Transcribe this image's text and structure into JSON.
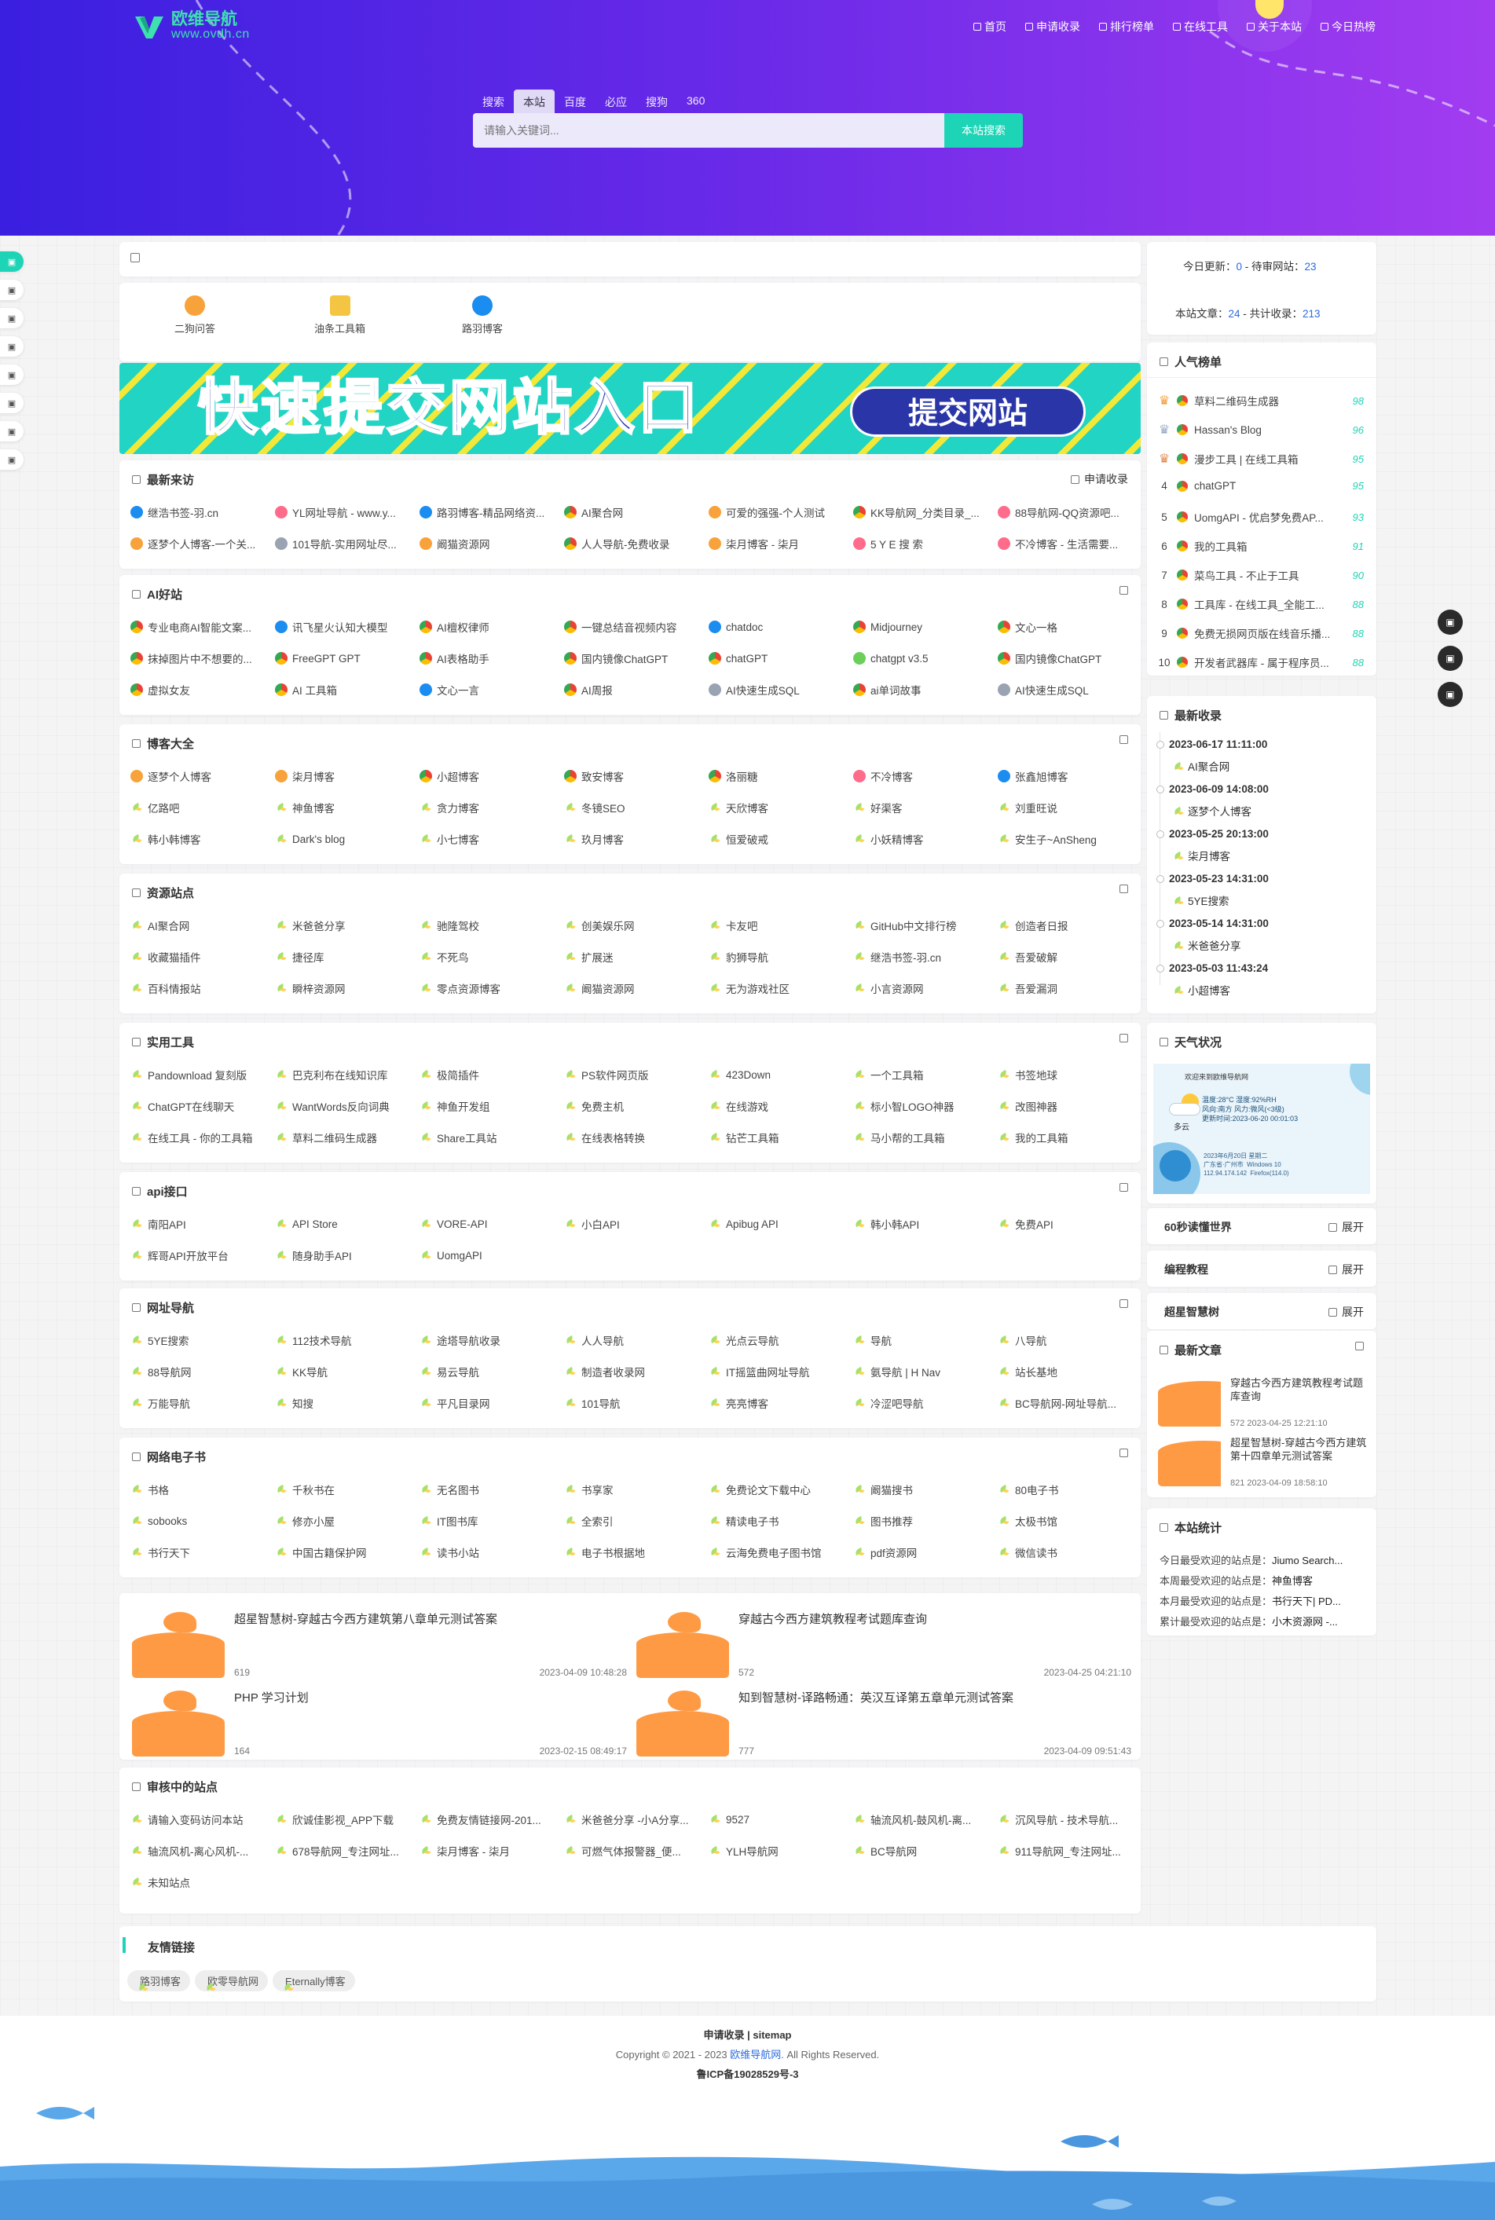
{
  "logo": {
    "title": "欧维导航",
    "url": "www.ovdh.cn"
  },
  "nav": [
    "首页",
    "申请收录",
    "排行榜单",
    "在线工具",
    "关于本站",
    "今日热榜"
  ],
  "search": {
    "tabs": [
      "搜索",
      "本站",
      "百度",
      "必应",
      "搜狗",
      "360"
    ],
    "active": 1,
    "placeholder": "请输入关键词...",
    "button": "本站搜索"
  },
  "hot_icons": [
    {
      "label": "二狗问答",
      "color": "#f7a23a"
    },
    {
      "label": "油条工具箱",
      "color": "#f4c542"
    },
    {
      "label": "路羽博客",
      "color": "#1b8cf0"
    }
  ],
  "banner": {
    "left": "快速提交网站入口",
    "right": "提交网站"
  },
  "sections": [
    {
      "id": "latest",
      "title": "最新来访",
      "right": "申请收录",
      "items": [
        [
          "书",
          "继浩书签-羽.cn"
        ],
        [
          "c5",
          "YL网址导航 - www.y..."
        ],
        [
          "c3",
          "路羽博客-精品网络资..."
        ],
        [
          "c1",
          "AI聚合网"
        ],
        [
          "c2",
          "可爱的强强-个人测试"
        ],
        [
          "c1",
          "KK导航网_分类目录_..."
        ],
        [
          "c5",
          "88导航网-QQ资源吧..."
        ],
        [
          "c2",
          "逐梦个人博客-一个关..."
        ],
        [
          "c6",
          "101导航-实用网址尽..."
        ],
        [
          "c2",
          "阚猫资源网"
        ],
        [
          "c1",
          "人人导航-免费收录"
        ],
        [
          "c2",
          "柒月博客 - 柒月"
        ],
        [
          "c5",
          "5 Y E 搜 索"
        ],
        [
          "c5",
          "不冷博客 - 生活需要..."
        ]
      ]
    },
    {
      "id": "ai",
      "title": "AI好站",
      "right": "",
      "items": [
        [
          "c1",
          "专业电商AI智能文案..."
        ],
        [
          "c3",
          "讯飞星火认知大模型"
        ],
        [
          "c1",
          "AI檀权律师"
        ],
        [
          "c1",
          "一键总结音视频内容"
        ],
        [
          "c3",
          "chatdoc"
        ],
        [
          "c1",
          "Midjourney"
        ],
        [
          "c1",
          "文心一格"
        ],
        [
          "c1",
          "抹掉图片中不想要的..."
        ],
        [
          "c1",
          "FreeGPT GPT"
        ],
        [
          "c1",
          "AI表格助手"
        ],
        [
          "c1",
          "国内镜像ChatGPT"
        ],
        [
          "c1",
          "chatGPT"
        ],
        [
          "c4",
          "chatgpt v3.5"
        ],
        [
          "c1",
          "国内镜像ChatGPT"
        ],
        [
          "c1",
          "虚拟女友"
        ],
        [
          "c1",
          "AI 工具箱"
        ],
        [
          "c3",
          "文心一言"
        ],
        [
          "c1",
          "AI周报"
        ],
        [
          "c6",
          "AI快速生成SQL"
        ],
        [
          "c1",
          "ai单词故事"
        ],
        [
          "c6",
          "AI快速生成SQL"
        ]
      ]
    },
    {
      "id": "blog",
      "title": "博客大全",
      "right": "",
      "items": [
        [
          "c2",
          "逐梦个人博客"
        ],
        [
          "c2",
          "柒月博客"
        ],
        [
          "c1",
          "小超博客"
        ],
        [
          "c1",
          "致安博客"
        ],
        [
          "c1",
          "洛丽糖"
        ],
        [
          "c5",
          "不冷博客"
        ],
        [
          "c3",
          "张鑫旭博客"
        ],
        [
          "leaf",
          "亿路吧"
        ],
        [
          "leaf",
          "神鱼博客"
        ],
        [
          "leaf",
          "贪力博客"
        ],
        [
          "leaf",
          "冬镜SEO"
        ],
        [
          "leaf",
          "天欣博客"
        ],
        [
          "leaf",
          "好渠客"
        ],
        [
          "leaf",
          "刘重旺说"
        ],
        [
          "leaf",
          "韩小韩博客"
        ],
        [
          "leaf",
          "Dark's blog"
        ],
        [
          "leaf",
          "小七博客"
        ],
        [
          "leaf",
          "玖月博客"
        ],
        [
          "leaf",
          "恒爱破戒"
        ],
        [
          "leaf",
          "小妖精博客"
        ],
        [
          "leaf",
          "安生子~AnSheng"
        ]
      ]
    },
    {
      "id": "res",
      "title": "资源站点",
      "right": "",
      "items": [
        [
          "leaf",
          "AI聚合网"
        ],
        [
          "leaf",
          "米爸爸分享"
        ],
        [
          "leaf",
          "驰隆驾校"
        ],
        [
          "leaf",
          "创美娱乐网"
        ],
        [
          "leaf",
          "卡友吧"
        ],
        [
          "leaf",
          "GitHub中文排行榜"
        ],
        [
          "leaf",
          "创造者日报"
        ],
        [
          "leaf",
          "收藏猫插件"
        ],
        [
          "leaf",
          "捷径库"
        ],
        [
          "leaf",
          "不死鸟"
        ],
        [
          "leaf",
          "扩展迷"
        ],
        [
          "leaf",
          "豹狮导航"
        ],
        [
          "leaf",
          "继浩书签-羽.cn"
        ],
        [
          "leaf",
          "吾爱破解"
        ],
        [
          "leaf",
          "百科情报站"
        ],
        [
          "leaf",
          "瞬梓资源网"
        ],
        [
          "leaf",
          "零点资源博客"
        ],
        [
          "leaf",
          "阚猫资源网"
        ],
        [
          "leaf",
          "无为游戏社区"
        ],
        [
          "leaf",
          "小言资源网"
        ],
        [
          "leaf",
          "吾爱漏洞"
        ]
      ]
    },
    {
      "id": "tools",
      "title": "实用工具",
      "right": "",
      "items": [
        [
          "leaf",
          "Pandownload 复刻版"
        ],
        [
          "leaf",
          "巴克利布在线知识库"
        ],
        [
          "leaf",
          "极简插件"
        ],
        [
          "leaf",
          "PS软件网页版"
        ],
        [
          "leaf",
          "423Down"
        ],
        [
          "leaf",
          "一个工具箱"
        ],
        [
          "leaf",
          "书签地球"
        ],
        [
          "leaf",
          "ChatGPT在线聊天"
        ],
        [
          "leaf",
          "WantWords反向词典"
        ],
        [
          "leaf",
          "神鱼开发组"
        ],
        [
          "leaf",
          "免费主机"
        ],
        [
          "leaf",
          "在线游戏"
        ],
        [
          "leaf",
          "标小智LOGO神器"
        ],
        [
          "leaf",
          "改图神器"
        ],
        [
          "leaf",
          "在线工具 - 你的工具箱"
        ],
        [
          "leaf",
          "草料二维码生成器"
        ],
        [
          "leaf",
          "Share工具站"
        ],
        [
          "leaf",
          "在线表格转换"
        ],
        [
          "leaf",
          "钻芒工具箱"
        ],
        [
          "leaf",
          "马小帮的工具箱"
        ],
        [
          "leaf",
          "我的工具箱"
        ]
      ]
    },
    {
      "id": "api",
      "title": "api接口",
      "right": "",
      "items": [
        [
          "leaf",
          "南阳API"
        ],
        [
          "leaf",
          "API Store"
        ],
        [
          "leaf",
          "VORE-API"
        ],
        [
          "leaf",
          "小白API"
        ],
        [
          "leaf",
          "Apibug API"
        ],
        [
          "leaf",
          "韩小韩API"
        ],
        [
          "leaf",
          "免费API"
        ],
        [
          "leaf",
          "辉哥API开放平台"
        ],
        [
          "leaf",
          "随身助手API"
        ],
        [
          "leaf",
          "UomgAPI"
        ]
      ]
    },
    {
      "id": "nav",
      "title": "网址导航",
      "right": "",
      "items": [
        [
          "leaf",
          "5YE搜索"
        ],
        [
          "leaf",
          "112技术导航"
        ],
        [
          "leaf",
          "途塔导航收录"
        ],
        [
          "leaf",
          "人人导航"
        ],
        [
          "leaf",
          "光点云导航"
        ],
        [
          "leaf",
          "导航"
        ],
        [
          "leaf",
          "八导航"
        ],
        [
          "leaf",
          "88导航网"
        ],
        [
          "leaf",
          "KK导航"
        ],
        [
          "leaf",
          "易云导航"
        ],
        [
          "leaf",
          "制造者收录网"
        ],
        [
          "leaf",
          "IT摇篮曲网址导航"
        ],
        [
          "leaf",
          "氨导航 | H Nav"
        ],
        [
          "leaf",
          "站长基地"
        ],
        [
          "leaf",
          "万能导航"
        ],
        [
          "leaf",
          "知搜"
        ],
        [
          "leaf",
          "平凡目录网"
        ],
        [
          "leaf",
          "101导航"
        ],
        [
          "leaf",
          "亮亮博客"
        ],
        [
          "leaf",
          "冷涩吧导航"
        ],
        [
          "leaf",
          "BC导航网-网址导航..."
        ]
      ]
    },
    {
      "id": "ebook",
      "title": "网络电子书",
      "right": "",
      "items": [
        [
          "leaf",
          "书格"
        ],
        [
          "leaf",
          "千秋书在"
        ],
        [
          "leaf",
          "无名图书"
        ],
        [
          "leaf",
          "书享家"
        ],
        [
          "leaf",
          "免费论文下载中心"
        ],
        [
          "leaf",
          "阚猫搜书"
        ],
        [
          "leaf",
          "80电子书"
        ],
        [
          "leaf",
          "sobooks"
        ],
        [
          "leaf",
          "修亦小屋"
        ],
        [
          "leaf",
          "IT图书库"
        ],
        [
          "leaf",
          "全索引"
        ],
        [
          "leaf",
          "精读电子书"
        ],
        [
          "leaf",
          "图书推荐"
        ],
        [
          "leaf",
          "太极书馆"
        ],
        [
          "leaf",
          "书行天下"
        ],
        [
          "leaf",
          "中国古籍保护网"
        ],
        [
          "leaf",
          "读书小站"
        ],
        [
          "leaf",
          "电子书根据地"
        ],
        [
          "leaf",
          "云海免费电子图书馆"
        ],
        [
          "leaf",
          "pdf资源网"
        ],
        [
          "leaf",
          "微信读书"
        ]
      ]
    }
  ],
  "posts": [
    {
      "title": "超星智慧树-穿越古今西方建筑第八章单元测试答案",
      "views": "619",
      "date": "2023-04-09 10:48:28"
    },
    {
      "title": "穿越古今西方建筑教程考试题库查询",
      "views": "572",
      "date": "2023-04-25 04:21:10"
    },
    {
      "title": "PHP 学习计划",
      "views": "164",
      "date": "2023-02-15 08:49:17"
    },
    {
      "title": "知到智慧树-译路畅通：英汉互译第五章单元测试答案",
      "views": "777",
      "date": "2023-04-09 09:51:43"
    }
  ],
  "review": {
    "title": "审核中的站点",
    "items": [
      [
        "leaf",
        "请输入变码访问本站"
      ],
      [
        "leaf",
        "欣诚佳影视_APP下载"
      ],
      [
        "leaf",
        "免费友情链接网-201..."
      ],
      [
        "leaf",
        "米爸爸分享 -小A分享..."
      ],
      [
        "leaf",
        "9527"
      ],
      [
        "leaf",
        "轴流风机-鼓风机-离..."
      ],
      [
        "leaf",
        "沉风导航 - 技术导航..."
      ],
      [
        "leaf",
        "轴流风机-离心风机-..."
      ],
      [
        "leaf",
        "678导航网_专注网址..."
      ],
      [
        "leaf",
        "柒月博客 - 柒月"
      ],
      [
        "leaf",
        "可燃气体报警器_便..."
      ],
      [
        "leaf",
        "YLH导航网"
      ],
      [
        "leaf",
        "BC导航网"
      ],
      [
        "leaf",
        "911导航网_专注网址..."
      ],
      [
        "leaf",
        "未知站点"
      ]
    ]
  },
  "friends": {
    "title": "友情链接",
    "items": [
      "路羽博客",
      "欧零导航网",
      "Eternally博客"
    ]
  },
  "stats_top": {
    "today_update_label": "今日更新：",
    "today_update": "0",
    "pending_label": " - 待审网站：",
    "pending": "23",
    "articles_label": "本站文章：",
    "articles": "24",
    "total_label": " - 共计收录：",
    "total": "213"
  },
  "ranking": {
    "title": "人气榜单",
    "items": [
      {
        "n": "1",
        "name": "草料二维码生成器",
        "score": "98"
      },
      {
        "n": "2",
        "name": "Hassan's Blog",
        "score": "96"
      },
      {
        "n": "3",
        "name": "漫步工具 | 在线工具箱",
        "score": "95"
      },
      {
        "n": "4",
        "name": "chatGPT",
        "score": "95"
      },
      {
        "n": "5",
        "name": "UomgAPI - 优启梦免费AP...",
        "score": "93"
      },
      {
        "n": "6",
        "name": "我的工具箱",
        "score": "91"
      },
      {
        "n": "7",
        "name": "菜鸟工具 - 不止于工具",
        "score": "90"
      },
      {
        "n": "8",
        "name": "工具库 - 在线工具_全能工...",
        "score": "88"
      },
      {
        "n": "9",
        "name": "免费无损网页版在线音乐播...",
        "score": "88"
      },
      {
        "n": "10",
        "name": "开发者武器库 - 属于程序员...",
        "score": "88"
      }
    ]
  },
  "newest": {
    "title": "最新收录",
    "items": [
      {
        "date": "2023-06-17 11:11:00",
        "name": "AI聚合网"
      },
      {
        "date": "2023-06-09 14:08:00",
        "name": "逐梦个人博客"
      },
      {
        "date": "2023-05-25 20:13:00",
        "name": "柒月博客"
      },
      {
        "date": "2023-05-23 14:31:00",
        "name": "5YE搜索"
      },
      {
        "date": "2023-05-14 14:31:00",
        "name": "米爸爸分享"
      },
      {
        "date": "2023-05-03 11:43:24",
        "name": "小超博客"
      }
    ]
  },
  "weather": {
    "title": "天气状况",
    "welcome": "欢迎来到欧维导航网",
    "temp": "温度:28°C 湿度:92%RH",
    "wind": "风向:南方  风力:微风(<3级)",
    "updated": "更新时间:2023-06-20 00:01:03",
    "cond": "多云",
    "date": "2023年6月20日 星期二",
    "loc": "广东省·广州市",
    "os": "Windows 10",
    "ip": "112.94.174.142",
    "browser": "Firefox(114.0)"
  },
  "collapsibles": [
    {
      "title": "60秒读懂世界",
      "action": "展开"
    },
    {
      "title": "编程教程",
      "action": "展开"
    },
    {
      "title": "超星智慧树",
      "action": "展开"
    }
  ],
  "recent": {
    "title": "最新文章",
    "items": [
      {
        "title": "穿越古今西方建筑教程考试题库查询",
        "views": "572",
        "date": "2023-04-25 12:21:10"
      },
      {
        "title": "超星智慧树-穿越古今西方建筑第十四章单元测试答案",
        "views": "821",
        "date": "2023-04-09 18:58:10"
      }
    ]
  },
  "sitestats": {
    "title": "本站统计",
    "rows": [
      {
        "label": "今日最受欢迎的站点是：",
        "value": "Jiumo Search..."
      },
      {
        "label": "本周最受欢迎的站点是：",
        "value": "神鱼博客"
      },
      {
        "label": "本月最受欢迎的站点是：",
        "value": "书行天下| PD..."
      },
      {
        "label": "累计最受欢迎的站点是：",
        "value": "小木资源网 -..."
      }
    ]
  },
  "footer": {
    "links": "申请收录 | sitemap",
    "copyright_pre": "Copyright © 2021 - 2023 ",
    "copyright_brand": "欧维导航网",
    "copyright_post": ". All Rights Reserved.",
    "icp": "鲁ICP备19028529号-3"
  },
  "leftbar_count": 8,
  "colors": {
    "accent": "#1ed4b6",
    "hero_start": "#3a1fe0",
    "hero_end": "#a23cf0",
    "link_blue": "#2b6be0"
  }
}
